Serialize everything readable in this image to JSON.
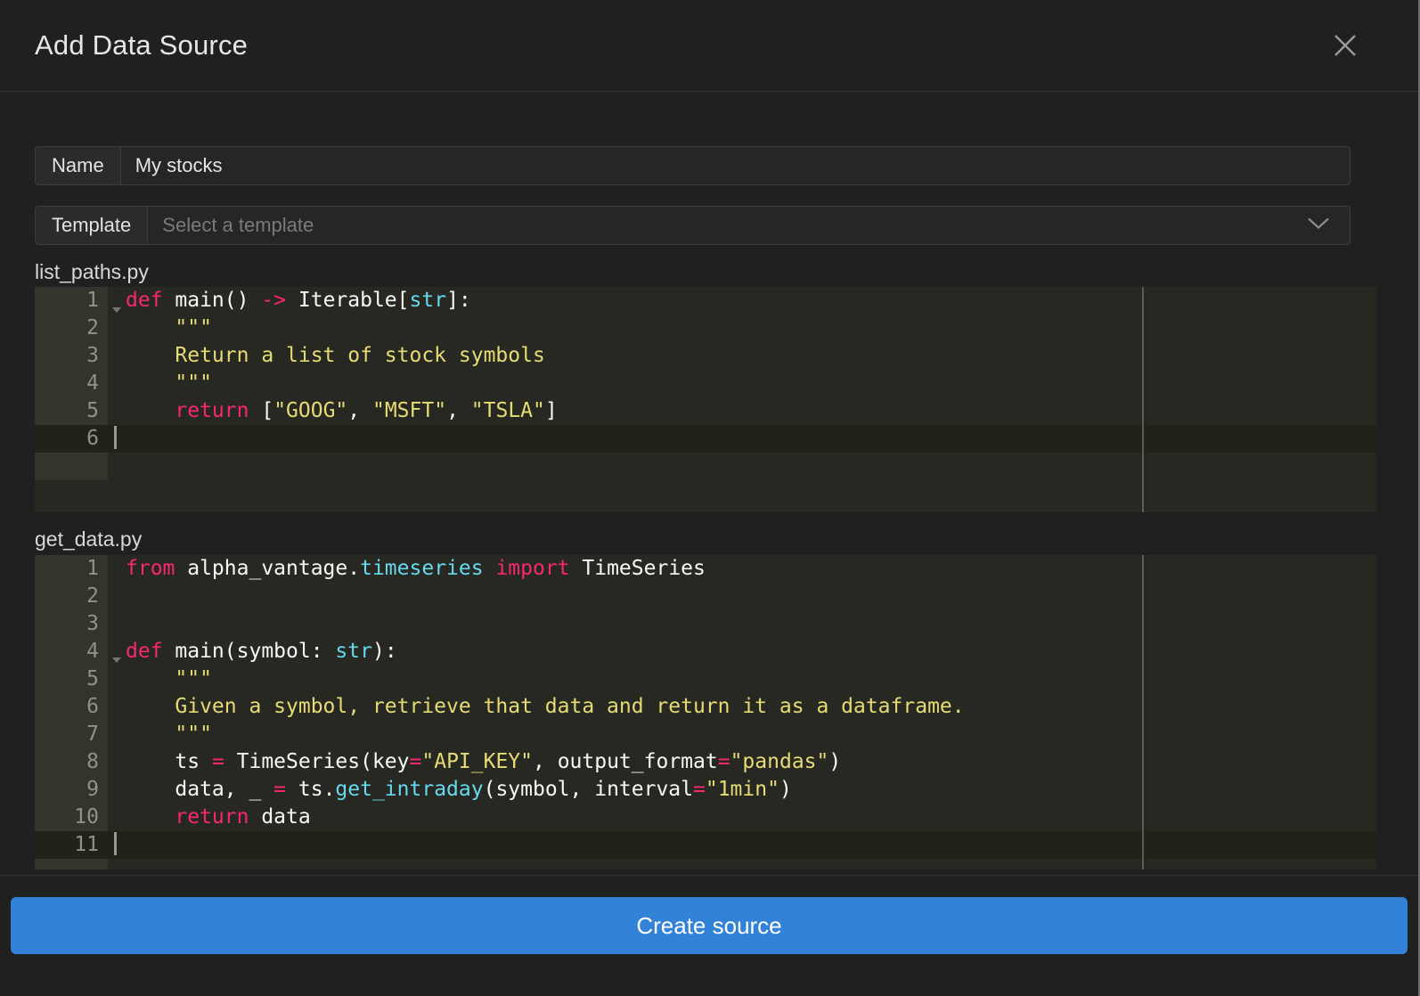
{
  "modal": {
    "title": "Add Data Source",
    "close_icon": "close-icon"
  },
  "form": {
    "name_label": "Name",
    "name_value": "My stocks",
    "template_label": "Template",
    "template_placeholder": "Select a template",
    "template_value": "",
    "chevron_icon": "chevron-down-icon"
  },
  "editors": [
    {
      "filename": "list_paths.py",
      "active_line": 6,
      "lines": [
        {
          "n": "1",
          "fold": true,
          "tokens": [
            {
              "t": "def",
              "c": "kw"
            },
            {
              "t": " main() ",
              "c": "pl"
            },
            {
              "t": "->",
              "c": "op"
            },
            {
              "t": " Iterable[",
              "c": "pl"
            },
            {
              "t": "str",
              "c": "typ"
            },
            {
              "t": "]:",
              "c": "pl"
            }
          ]
        },
        {
          "n": "2",
          "fold": false,
          "tokens": [
            {
              "t": "    \"\"\"",
              "c": "str"
            }
          ]
        },
        {
          "n": "3",
          "fold": false,
          "tokens": [
            {
              "t": "    Return a list of stock symbols",
              "c": "str"
            }
          ]
        },
        {
          "n": "4",
          "fold": false,
          "tokens": [
            {
              "t": "    \"\"\"",
              "c": "str"
            }
          ]
        },
        {
          "n": "5",
          "fold": false,
          "tokens": [
            {
              "t": "    ",
              "c": "pl"
            },
            {
              "t": "return",
              "c": "kw"
            },
            {
              "t": " [",
              "c": "pl"
            },
            {
              "t": "\"GOOG\"",
              "c": "str"
            },
            {
              "t": ", ",
              "c": "pl"
            },
            {
              "t": "\"MSFT\"",
              "c": "str"
            },
            {
              "t": ", ",
              "c": "pl"
            },
            {
              "t": "\"TSLA\"",
              "c": "str"
            },
            {
              "t": "]",
              "c": "pl"
            }
          ]
        },
        {
          "n": "6",
          "fold": false,
          "caret": true,
          "tokens": []
        }
      ]
    },
    {
      "filename": "get_data.py",
      "active_line": 11,
      "lines": [
        {
          "n": "1",
          "fold": false,
          "tokens": [
            {
              "t": "from",
              "c": "kw"
            },
            {
              "t": " alpha_vantage.",
              "c": "pl"
            },
            {
              "t": "timeseries",
              "c": "typ"
            },
            {
              "t": " ",
              "c": "pl"
            },
            {
              "t": "import",
              "c": "kw"
            },
            {
              "t": " TimeSeries",
              "c": "pl"
            }
          ]
        },
        {
          "n": "2",
          "fold": false,
          "tokens": []
        },
        {
          "n": "3",
          "fold": false,
          "tokens": []
        },
        {
          "n": "4",
          "fold": true,
          "tokens": [
            {
              "t": "def",
              "c": "kw"
            },
            {
              "t": " main(symbol: ",
              "c": "pl"
            },
            {
              "t": "str",
              "c": "typ"
            },
            {
              "t": "):",
              "c": "pl"
            }
          ]
        },
        {
          "n": "5",
          "fold": false,
          "tokens": [
            {
              "t": "    \"\"\"",
              "c": "str"
            }
          ]
        },
        {
          "n": "6",
          "fold": false,
          "tokens": [
            {
              "t": "    Given a symbol, retrieve that data and return it as a dataframe.",
              "c": "str"
            }
          ]
        },
        {
          "n": "7",
          "fold": false,
          "tokens": [
            {
              "t": "    \"\"\"",
              "c": "str"
            }
          ]
        },
        {
          "n": "8",
          "fold": false,
          "tokens": [
            {
              "t": "    ts ",
              "c": "pl"
            },
            {
              "t": "=",
              "c": "op"
            },
            {
              "t": " TimeSeries(key",
              "c": "pl"
            },
            {
              "t": "=",
              "c": "op"
            },
            {
              "t": "\"API_KEY\"",
              "c": "str"
            },
            {
              "t": ", output_format",
              "c": "pl"
            },
            {
              "t": "=",
              "c": "op"
            },
            {
              "t": "\"pandas\"",
              "c": "str"
            },
            {
              "t": ")",
              "c": "pl"
            }
          ]
        },
        {
          "n": "9",
          "fold": false,
          "tokens": [
            {
              "t": "    data, _ ",
              "c": "pl"
            },
            {
              "t": "=",
              "c": "op"
            },
            {
              "t": " ts.",
              "c": "pl"
            },
            {
              "t": "get_intraday",
              "c": "fn"
            },
            {
              "t": "(symbol, interval",
              "c": "pl"
            },
            {
              "t": "=",
              "c": "op"
            },
            {
              "t": "\"1min\"",
              "c": "str"
            },
            {
              "t": ")",
              "c": "pl"
            }
          ]
        },
        {
          "n": "10",
          "fold": false,
          "tokens": [
            {
              "t": "    ",
              "c": "pl"
            },
            {
              "t": "return",
              "c": "kw"
            },
            {
              "t": " data",
              "c": "pl"
            }
          ]
        },
        {
          "n": "11",
          "fold": false,
          "caret": true,
          "tokens": []
        }
      ]
    }
  ],
  "footer": {
    "create_label": "Create source"
  },
  "colors": {
    "accent": "#3282d7",
    "editor_bg": "#272822",
    "gutter_bg": "#33342c",
    "keyword": "#f92672",
    "string": "#e6db74",
    "type": "#66d9ef",
    "plain": "#f8f8f2",
    "modal_bg": "#202020"
  }
}
